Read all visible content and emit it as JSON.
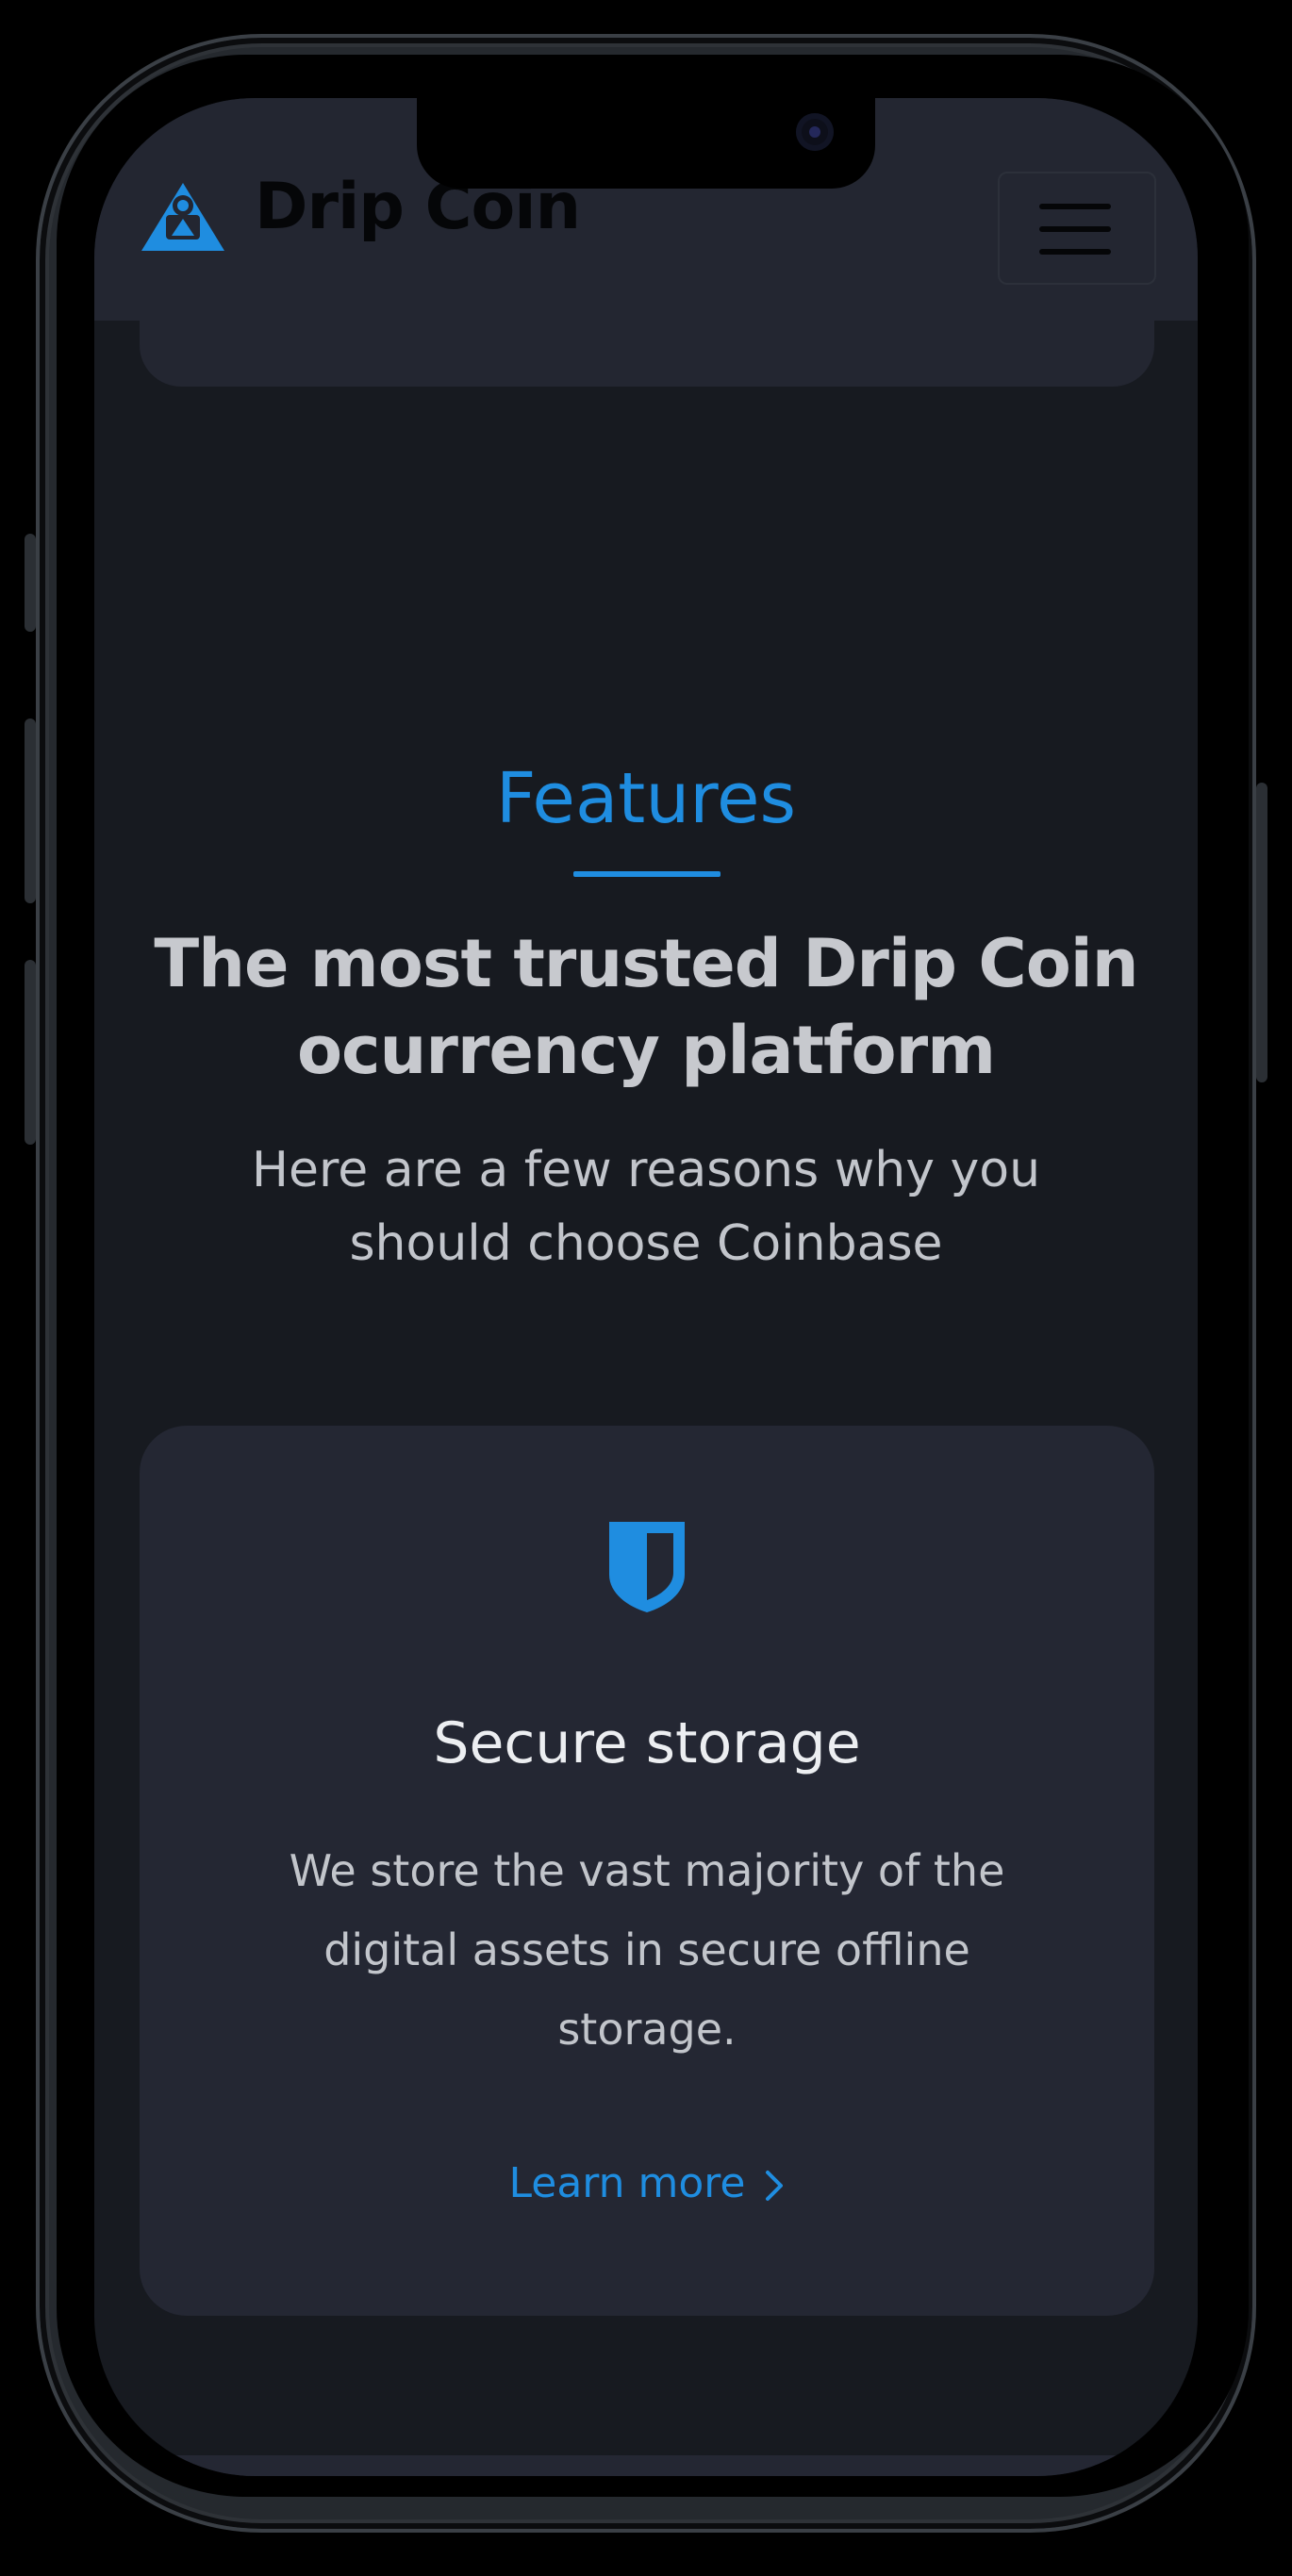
{
  "header": {
    "brand_name": "Drip Coin",
    "logo_icon": "pyramid-logo-icon",
    "menu_icon": "hamburger-menu-icon"
  },
  "features": {
    "eyebrow": "Features",
    "headline_line1": "The most trusted Drip Coin",
    "headline_line2": "ocurrency platform",
    "subhead_line1": "Here are a few reasons why you",
    "subhead_line2": "should choose Coinbase"
  },
  "card": {
    "icon": "shield-icon",
    "title": "Secure storage",
    "desc_line1": "We store the vast majority of the",
    "desc_line2": "digital assets in secure offline",
    "desc_line3": "storage.",
    "link_label": "Learn more"
  },
  "colors": {
    "accent": "#1f8de0",
    "background": "#171a20",
    "card": "#242733",
    "header": "#232631"
  }
}
